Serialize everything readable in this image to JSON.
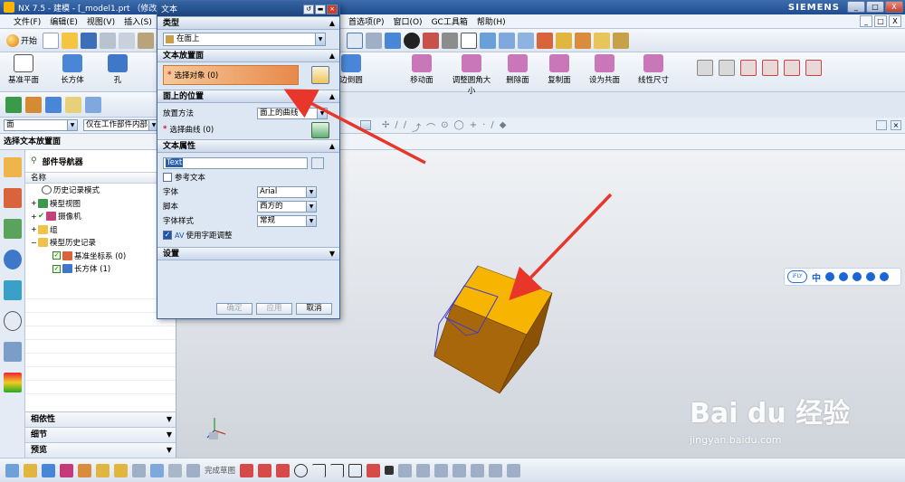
{
  "window": {
    "title": "NX 7.5 - 建模 - [_model1.prt （修改的",
    "brand": "SIEMENS",
    "controls": [
      "_",
      "□",
      "X"
    ]
  },
  "menubar": {
    "left": [
      "文件(F)",
      "编辑(E)",
      "视图(V)",
      "插入(S)"
    ],
    "right": [
      "首选项(P)",
      "窗口(O)",
      "GC工具箱",
      "帮助(H)"
    ]
  },
  "toolbar1": {
    "start_label": "开始"
  },
  "toolbar2": {
    "left_tools": [
      "基准平面",
      "长方体",
      "孔"
    ],
    "right_tools": [
      "移动面",
      "调整圆角大小",
      "删除面",
      "复制面",
      "设为共面",
      "线性尺寸"
    ],
    "partial_label": "边倒圆"
  },
  "filterbar": {
    "type_filter": "面",
    "scope_filter": "仅在工作部件内部"
  },
  "status": {
    "prompt": "选择文本放置面"
  },
  "navigator": {
    "title": "部件导航器",
    "column": "名称",
    "tree": [
      {
        "label": "历史记录模式",
        "indent": 1,
        "icon": "clock-icon"
      },
      {
        "label": "模型视图",
        "indent": 0,
        "icon": "model-view-icon"
      },
      {
        "label": "摄像机",
        "indent": 0,
        "icon": "camera-icon"
      },
      {
        "label": "组",
        "indent": 0,
        "icon": "folder-icon"
      },
      {
        "label": "模型历史记录",
        "indent": 0,
        "icon": "folder-icon"
      },
      {
        "label": "基准坐标系 (0)",
        "indent": 2,
        "icon": "datum-csys-icon"
      },
      {
        "label": "长方体 (1)",
        "indent": 2,
        "icon": "block-icon"
      }
    ],
    "footer": [
      "相依性",
      "细节",
      "预览"
    ]
  },
  "dialog": {
    "title": "文本",
    "type_section": "类型",
    "type_value": "在面上",
    "placement_face_section": "文本放置面",
    "select_object": "选择对象 (0)",
    "placement_section": "面上的位置",
    "placement_method_label": "放置方法",
    "placement_method_value": "面上的曲线",
    "select_curve": "选择曲线 (0)",
    "text_props_section": "文本属性",
    "text_value": "Text",
    "reference_text": "参考文本",
    "font_label": "字体",
    "font_value": "Arial",
    "script_label": "脚本",
    "script_value": "西方的",
    "style_label": "字体样式",
    "style_value": "常规",
    "kerning_label": "使用字距调整",
    "settings_section": "设置",
    "ok": "确定",
    "apply": "应用",
    "cancel": "取消"
  },
  "bottombar": {
    "finish_sketch": "完成草图"
  },
  "ifly": {
    "badge": "iFLY",
    "lang": "中"
  },
  "watermark": {
    "brand": "Bai du 经验",
    "url": "jingyan.baidu.com"
  },
  "colors": {
    "cube_top": "#f7b400",
    "cube_side": "#a8670a",
    "arrow": "#e8362b",
    "dialog_highlight": "#e7894a"
  }
}
